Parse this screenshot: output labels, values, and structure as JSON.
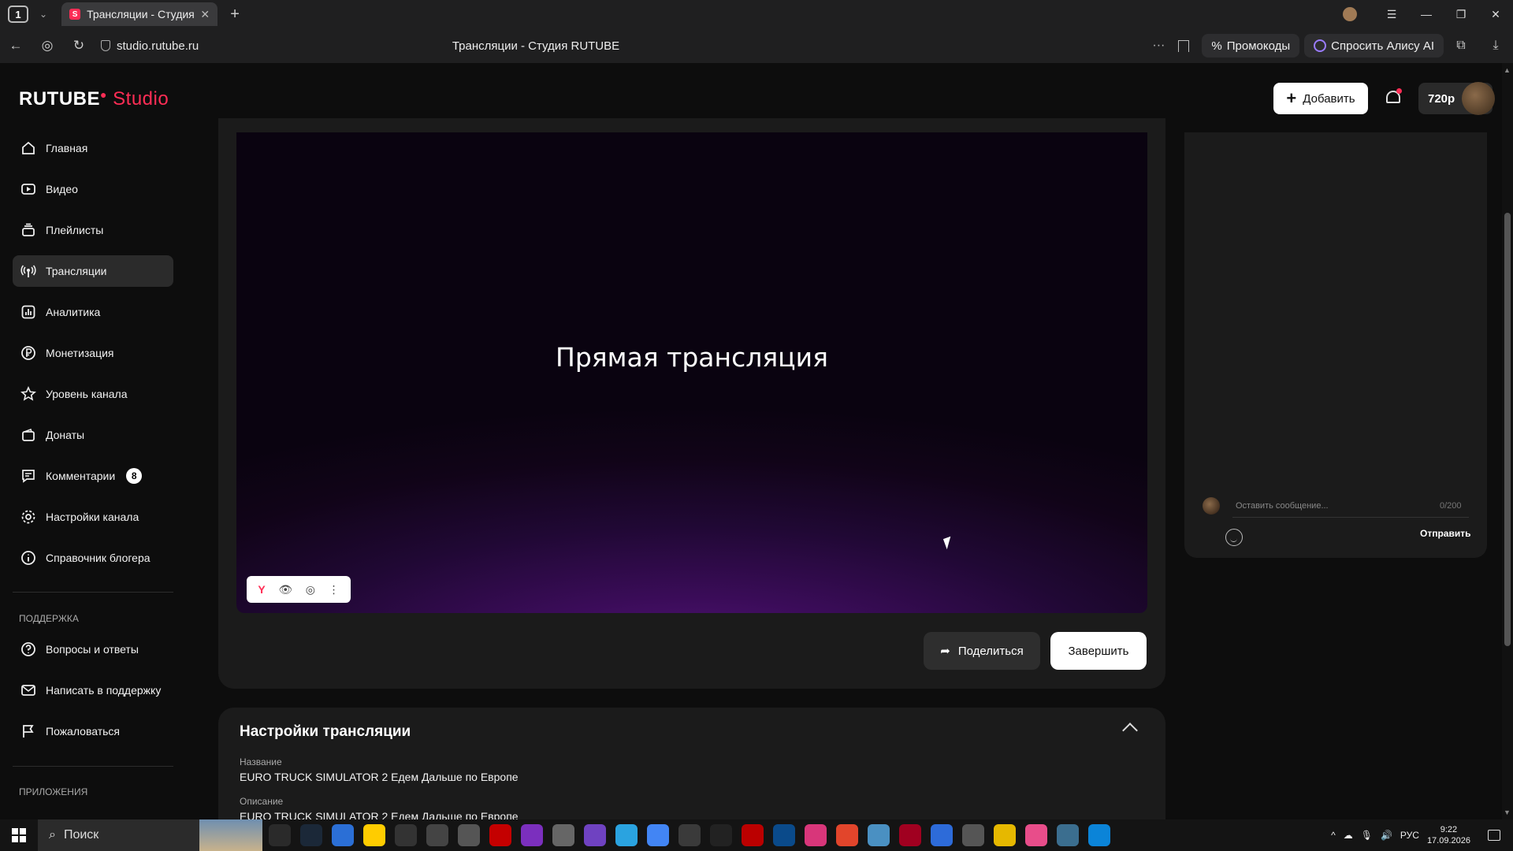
{
  "browser": {
    "tab_count": "1",
    "tab_title": "Трансляции - Студия R",
    "url": "studio.rutube.ru",
    "page_title": "Трансляции - Студия RUTUBE",
    "promo_label": "Промокоды",
    "alice_label": "Спросить Алису AI"
  },
  "header": {
    "logo_main": "RUTUBE",
    "logo_sub": "Studio",
    "add_label": "Добавить",
    "resolution": "720p"
  },
  "sidebar": {
    "items": [
      {
        "label": "Главная"
      },
      {
        "label": "Видео"
      },
      {
        "label": "Плейлисты"
      },
      {
        "label": "Трансляции"
      },
      {
        "label": "Аналитика"
      },
      {
        "label": "Монетизация"
      },
      {
        "label": "Уровень канала"
      },
      {
        "label": "Донаты"
      },
      {
        "label": "Комментарии",
        "badge": "8"
      },
      {
        "label": "Настройки канала"
      },
      {
        "label": "Справочник блогера"
      }
    ],
    "support_heading": "ПОДДЕРЖКА",
    "support_items": [
      {
        "label": "Вопросы и ответы"
      },
      {
        "label": "Написать в поддержку"
      },
      {
        "label": "Пожаловаться"
      }
    ],
    "apps_heading": "ПРИЛОЖЕНИЯ"
  },
  "player": {
    "title": "Прямая трансляция",
    "share_label": "Поделиться",
    "end_label": "Завершить"
  },
  "settings": {
    "title": "Настройки трансляции",
    "name_label": "Название",
    "name_value": "EURO TRUCK SIMULATOR 2 Едем Дальше по Европе",
    "desc_label": "Описание",
    "desc_value": "EURO TRUCK SIMULATOR 2 Едем Дальше по Европе"
  },
  "chat": {
    "placeholder": "Оставить сообщение...",
    "counter": "0/200",
    "send_label": "Отправить"
  },
  "taskbar": {
    "search_label": "Поиск",
    "lang": "РУС",
    "time": "9:22",
    "date": "17.09.2026"
  },
  "colors": {
    "accent": "#ff2d55",
    "panel": "#1b1b1b",
    "background": "#0d0d0d"
  }
}
